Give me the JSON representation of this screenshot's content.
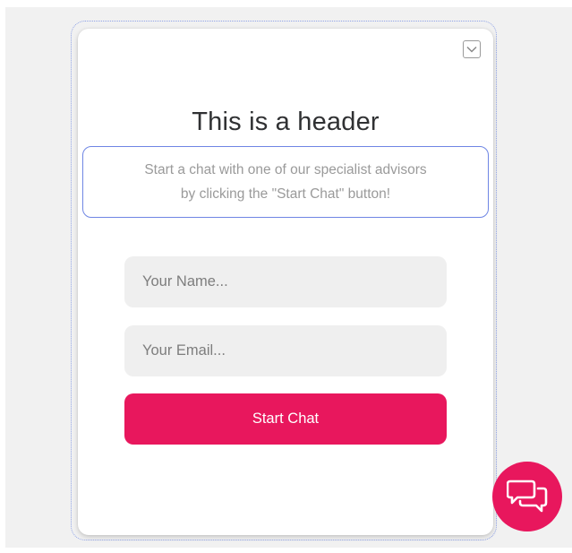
{
  "widget": {
    "header_title": "This is a header",
    "intro_line1": "Start a chat with one of our specialist advisors",
    "intro_line2": "by clicking the \"Start Chat\" button!",
    "minimize_icon": "chevron-down-icon"
  },
  "form": {
    "name_placeholder": "Your Name...",
    "name_value": "",
    "email_placeholder": "Your Email...",
    "email_value": "",
    "start_label": "Start Chat"
  },
  "launcher": {
    "icon": "chat-bubbles-icon"
  },
  "colors": {
    "accent": "#e8175d",
    "focus_border": "#6f86e4",
    "field_bg": "#efefef",
    "backdrop": "#f1f1f1"
  }
}
